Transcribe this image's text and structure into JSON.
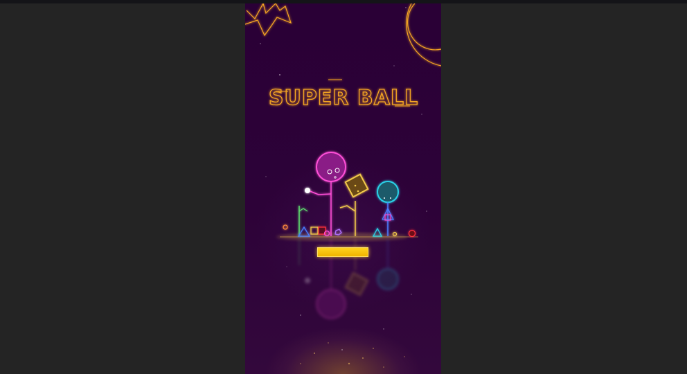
{
  "game": {
    "title": "SUPER BALL",
    "loading_progress": 1.0
  },
  "colors": {
    "page_background": "#242424",
    "frame_background": "#2a0036",
    "neon_orange": "#f5a623",
    "neon_pink": "#ff4fd8",
    "neon_yellow": "#f2c94c",
    "neon_cyan": "#2ad1e8",
    "neon_blue": "#4a7dff",
    "neon_green": "#5ee06e",
    "neon_red": "#ff3040",
    "loading_bar": "#ffd21e"
  }
}
